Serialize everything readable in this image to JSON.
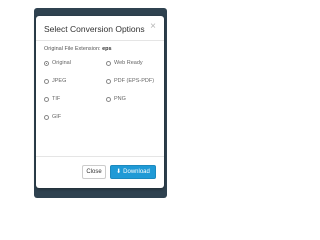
{
  "dialog": {
    "title": "Select Conversion Options",
    "close_glyph": "×"
  },
  "file_extension": {
    "label": "Original File Extension:",
    "value": "eps"
  },
  "options": [
    {
      "label": "Original",
      "checked": true
    },
    {
      "label": "Web Ready",
      "checked": false
    },
    {
      "label": "JPEG",
      "checked": false
    },
    {
      "label": "PDF (EPS-PDF)",
      "checked": false
    },
    {
      "label": "TIF",
      "checked": false
    },
    {
      "label": "PNG",
      "checked": false
    },
    {
      "label": "GIF",
      "checked": false
    }
  ],
  "footer": {
    "close_label": "Close",
    "download_label": "Download",
    "download_icon": "download-arrow-icon"
  },
  "colors": {
    "backdrop": "#2f4250",
    "primary": "#1f9ad6"
  }
}
